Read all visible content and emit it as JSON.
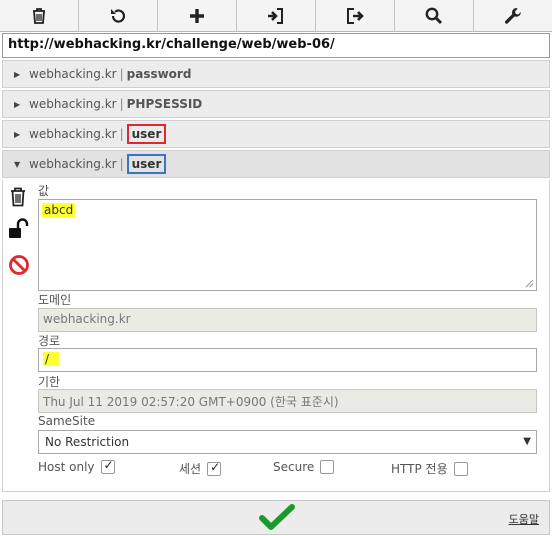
{
  "toolbar": {
    "buttons": [
      {
        "icon": "trash-icon"
      },
      {
        "icon": "undo-icon"
      },
      {
        "icon": "plus-icon"
      },
      {
        "icon": "import-icon"
      },
      {
        "icon": "export-icon"
      },
      {
        "icon": "search-icon"
      },
      {
        "icon": "wrench-icon"
      }
    ]
  },
  "url": "http://webhacking.kr/challenge/web/web-06/",
  "cookies": [
    {
      "domain": "webhacking.kr",
      "separator": "|",
      "name": "password"
    },
    {
      "domain": "webhacking.kr",
      "separator": "|",
      "name": "PHPSESSID"
    },
    {
      "domain": "webhacking.kr",
      "separator": "|",
      "name": "user"
    },
    {
      "domain": "webhacking.kr",
      "separator": "|",
      "name": "user"
    }
  ],
  "editor": {
    "value_label": "값",
    "value": "abcd",
    "domain_label": "도메인",
    "domain_value": "webhacking.kr",
    "path_label": "경로",
    "path_value": "/",
    "expires_label": "기한",
    "expires_value": "Thu Jul 11 2019 02:57:20 GMT+0900 (한국 표준시)",
    "samesite_label": "SameSite",
    "samesite_value": "No Restriction",
    "host_only_label": "Host only",
    "host_only_checked": true,
    "session_label": "세션",
    "session_checked": true,
    "secure_label": "Secure",
    "secure_checked": false,
    "http_only_label": "HTTP 전용",
    "http_only_checked": false
  },
  "footer": {
    "help_label": "도움말"
  },
  "colors": {
    "highlight": "#ffff33",
    "red_box": "#e0282f",
    "blue_box": "#3b73c7",
    "save_check": "#1a9a2a"
  }
}
